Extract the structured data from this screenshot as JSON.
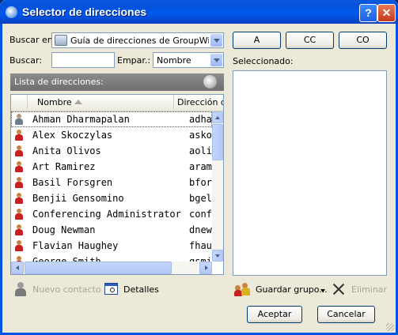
{
  "window": {
    "title": "Selector de direcciones",
    "help_label": "?",
    "close_label": "✕"
  },
  "search": {
    "buscar_en_label": "Buscar en:",
    "book_value": "Guía de direcciones de GroupWise de",
    "buscar_label": "Buscar:",
    "buscar_value": "",
    "empar_label": "Empar.:",
    "empar_value": "Nombre"
  },
  "recipients": {
    "to_label": "A",
    "cc_label": "CC",
    "bc_label": "CO",
    "selected_label": "Seleccionado:"
  },
  "list": {
    "header_label": "Lista de direcciones:",
    "col_name": "Nombre",
    "col_address": "Dirección de",
    "rows": [
      {
        "name": "Ahman Dharmapalan",
        "addr": "adhar",
        "icon": "grey"
      },
      {
        "name": "Alex Skoczylas",
        "addr": "askoc",
        "icon": "red"
      },
      {
        "name": "Anita Olivos",
        "addr": "aolivo",
        "icon": "red"
      },
      {
        "name": "Art Ramirez",
        "addr": "aramir",
        "icon": "red"
      },
      {
        "name": "Basil Forsgren",
        "addr": "bforsg",
        "icon": "red"
      },
      {
        "name": "Benjii Gensomino",
        "addr": "bgelso",
        "icon": "red"
      },
      {
        "name": "Conferencing Administrator",
        "addr": "confad",
        "icon": "red"
      },
      {
        "name": "Doug Newman",
        "addr": "dnewm",
        "icon": "red"
      },
      {
        "name": "Flavian Haughey",
        "addr": "fhaugh",
        "icon": "red"
      },
      {
        "name": "George Smith",
        "addr": "gsmith",
        "icon": "red"
      }
    ]
  },
  "footer": {
    "new_contact": "Nuevo contacto",
    "details": "Detalles",
    "save_group": "Guardar grupo...",
    "delete": "Eliminar",
    "accept": "Aceptar",
    "cancel": "Cancelar"
  }
}
